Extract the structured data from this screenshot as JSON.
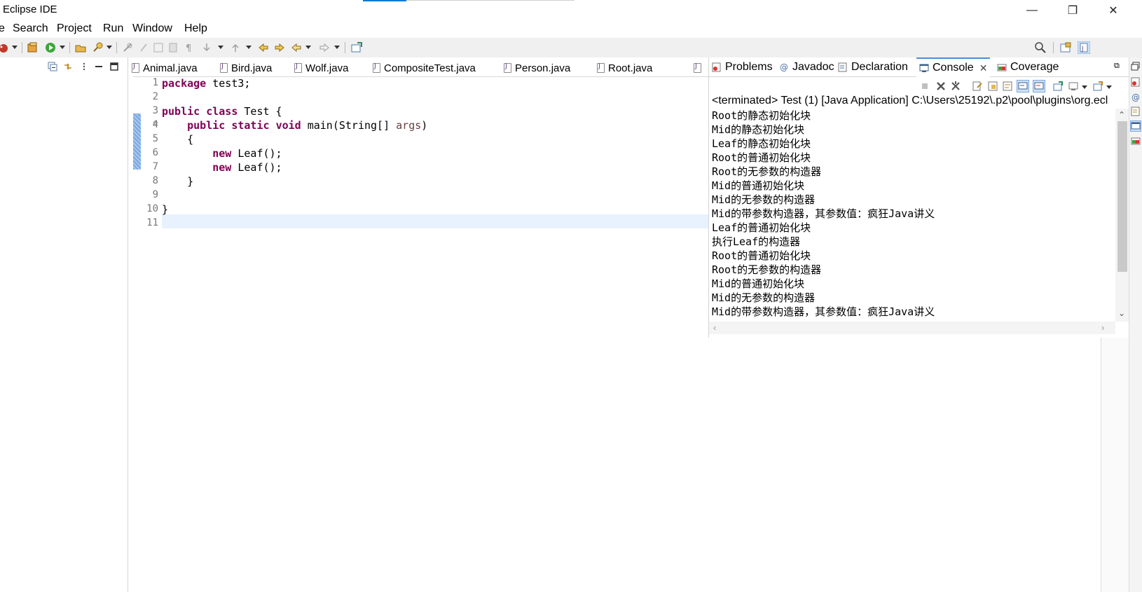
{
  "window": {
    "title": "Eclipse IDE",
    "controls": {
      "minimize": "—",
      "restore": "❐",
      "close": "✕"
    }
  },
  "menu": [
    "e",
    "Search",
    "Project",
    "Run",
    "Window",
    "Help"
  ],
  "editor": {
    "tabs": [
      "Animal.java",
      "Bird.java",
      "Wolf.java",
      "CompositeTest.java",
      "Person.java",
      "Root.java"
    ],
    "line_numbers": [
      "1",
      "2",
      "3",
      "4",
      "5",
      "6",
      "7",
      "8",
      "9",
      "10",
      "11"
    ],
    "code": {
      "l1_kw": "package",
      "l1_rest": " test3;",
      "l3_kw1": "public",
      "l3_kw2": "class",
      "l3_rest": " Test {",
      "l4_indent": "    ",
      "l4_kw1": "public",
      "l4_kw2": "static",
      "l4_kw3": "void",
      "l4_rest": " main(String[] ",
      "l4_param": "args",
      "l4_end": ")",
      "l5": "    {",
      "l6_indent": "        ",
      "l6_kw": "new",
      "l6_rest": " Leaf();",
      "l7_indent": "        ",
      "l7_kw": "new",
      "l7_rest": " Leaf();",
      "l8": "    }",
      "l10": "}"
    }
  },
  "views": {
    "tabs": [
      "Problems",
      "Javadoc",
      "Declaration",
      "Console",
      "Coverage"
    ],
    "active_tab": "Console",
    "console": {
      "status": "<terminated> Test (1) [Java Application] C:\\Users\\25192\\.p2\\pool\\plugins\\org.ecl",
      "output": [
        "Root的静态初始化块",
        "Mid的静态初始化块",
        "Leaf的静态初始化块",
        "Root的普通初始化块",
        "Root的无参数的构造器",
        "Mid的普通初始化块",
        "Mid的无参数的构造器",
        "Mid的带参数构造器，其参数值：疯狂Java讲义",
        "Leaf的普通初始化块",
        "执行Leaf的构造器",
        "Root的普通初始化块",
        "Root的无参数的构造器",
        "Mid的普通初始化块",
        "Mid的无参数的构造器",
        "Mid的带参数构造器，其参数值：疯狂Java讲义"
      ]
    }
  },
  "colors": {
    "keyword": "#7f0055",
    "param": "#6a3e3e",
    "current_line": "#e8f2fe",
    "active_tab_accent": "#4c8fd6"
  }
}
